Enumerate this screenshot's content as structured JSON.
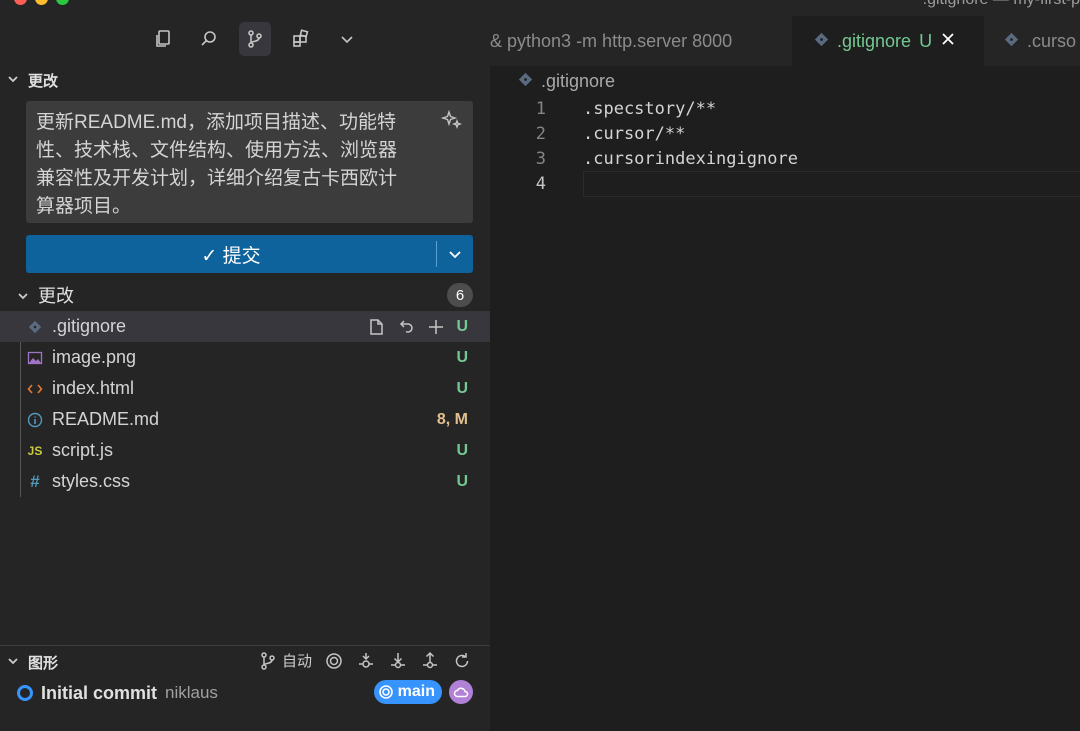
{
  "window": {
    "top_title": ".gitignore — my-first-p"
  },
  "scm": {
    "section_title": "更改",
    "commit_message": "更新README.md，添加项目描述、功能特性、技术栈、文件结构、使用方法、浏览器兼容性及开发计划，详细介绍复古卡西欧计算器项目。",
    "commit_button_label": "✓ 提交",
    "changes_label": "更改",
    "changes_count": "6",
    "files": [
      {
        "name": ".gitignore",
        "status": "U",
        "icon": "git-icon"
      },
      {
        "name": "image.png",
        "status": "U",
        "icon": "image-icon"
      },
      {
        "name": "index.html",
        "status": "U",
        "icon": "html-icon"
      },
      {
        "name": "README.md",
        "status": "8, M",
        "icon": "info-icon"
      },
      {
        "name": "script.js",
        "status": "U",
        "icon": "js-icon"
      },
      {
        "name": "styles.css",
        "status": "U",
        "icon": "css-icon"
      }
    ]
  },
  "graph": {
    "section_title": "图形",
    "auto_label": "自动",
    "commit_title": "Initial commit",
    "commit_author": "niklaus",
    "branch": "main"
  },
  "editor": {
    "tabs": [
      {
        "label": "& python3 -m http.server 8000"
      },
      {
        "label": ".gitignore",
        "badge": "U"
      },
      {
        "label": ".curso"
      }
    ],
    "breadcrumb": ".gitignore",
    "lines": [
      {
        "num": "1",
        "text": ".specstory/**"
      },
      {
        "num": "2",
        "text": ".cursor/**"
      },
      {
        "num": "3",
        "text": ".cursorindexingignore"
      },
      {
        "num": "4",
        "text": ""
      }
    ]
  },
  "colors": {
    "accent": "#0e639c",
    "untracked": "#73c991",
    "modified": "#e2c08d",
    "branch": "#3794ff"
  }
}
